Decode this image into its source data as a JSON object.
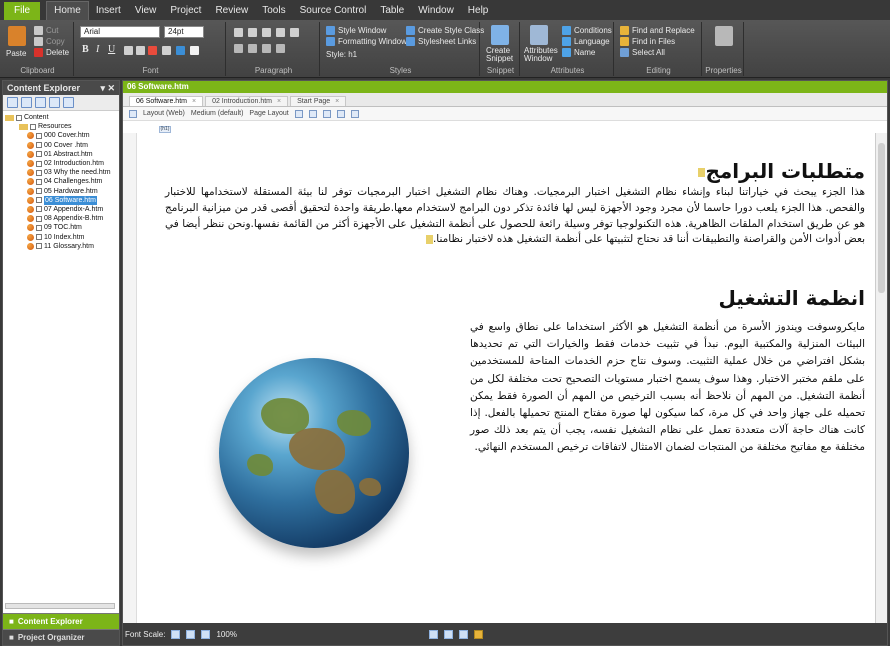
{
  "ribbon_tabs": [
    "File",
    "Home",
    "Insert",
    "View",
    "Project",
    "Review",
    "Tools",
    "Source Control",
    "Table",
    "Window",
    "Help"
  ],
  "clipboard": {
    "paste": "Paste",
    "cut": "Cut",
    "copy": "Copy",
    "delete": "Delete",
    "label": "Clipboard"
  },
  "font": {
    "family": "Arial",
    "size": "24pt",
    "label": "Font"
  },
  "paragraph": {
    "label": "Paragraph"
  },
  "styles": {
    "style_window": "Style Window",
    "formatting_window": "Formatting Window",
    "style_value": "Style: h1",
    "create_style_class": "Create Style Class",
    "stylesheet_links": "Stylesheet Links",
    "label": "Styles"
  },
  "snippet": {
    "create": "Create Snippet",
    "label": "Snippet"
  },
  "attributes": {
    "window": "Attributes Window",
    "conditions": "Conditions",
    "language": "Language",
    "name": "Name",
    "label": "Attributes"
  },
  "editing": {
    "find_replace": "Find and Replace",
    "find_in_files": "Find in Files",
    "select_all": "Select All",
    "label": "Editing"
  },
  "properties": {
    "label": "Properties"
  },
  "explorer": {
    "title": "Content Explorer",
    "root": "Content",
    "items": [
      "Resources",
      "000 Cover.htm",
      "00 Cover .htm",
      "01 Abstract.htm",
      "02 Introduction.htm",
      "03 Why the need.htm",
      "04 Challenges.htm",
      "05 Hardware.htm",
      "06 Software.htm",
      "07 Appendix-A.htm",
      "08 Appendix-B.htm",
      "09 TOC.htm",
      "10 Index.htm",
      "11 Glossary.htm"
    ],
    "selected_index": 8,
    "bottom_buttons": [
      "Content Explorer",
      "Project Organizer"
    ]
  },
  "document": {
    "window_title": "06 Software.htm",
    "tabs": [
      "06 Software.htm",
      "02 Introduction.htm",
      "Start Page"
    ],
    "toolbar": {
      "layout": "Layout (Web)",
      "medium": "Medium (default)",
      "page_layout": "Page Layout"
    },
    "tag": "(h1)",
    "heading1": "متطلبات البرامج",
    "para1": "هذا الجزء يبحث في خياراتنا لبناء وإنشاء نظام التشغيل اختبار البرمجيات. وهناك نظام التشغيل اختبار البرمجيات توفر لنا بيئة المستقلة لاستخدامها للاختبار والفحص. هذا الجزء يلعب دورا حاسما لأن مجرد وجود الأجهزة ليس لها فائدة تذكر دون البرامج لاستخدام معها.طريقة واحدة لتحقيق أقصى قدر من ميزانية البرنامج هو عن طريق استخدام الملقات الظاهرية. هذه التكنولوجيا توفر وسيلة رائعة للحصول على أنظمة التشغيل على الأجهزة أكثر من القائمة نفسها.ونحن ننظر أيضا في بعض أدوات الأمن والقراصنة والتطبيقات أننا قد نحتاج لتثبيتها على أنظمة التشغيل هذه لاختبار نظامنا.",
    "heading2": "انظمة التشغيل",
    "para2": "مايكروسوفت ويندوز الأسرة من أنظمة التشغيل هو الأكثر استخداما على نطاق واسع في البيئات المنزلية والمكتبية اليوم. نبدأ في تثبيت خدمات فقط والخيارات التي تم تحديدها بشكل افتراضي من خلال عملية التثبيت. وسوف نتاح حزم الخدمات المتاحة للمستخدمين على ملقم مختبر الاختبار. وهذا سوف يسمح اختبار مستويات التصحيح تحت مختلفة لكل من أنظمة التشغيل. من المهم أن نلاحظ أنه بسبب الترخيص من المهم أن الصورة فقط يمكن تحميله على جهاز واحد في كل مرة، كما سيكون لها صورة مفتاح المنتج تحميلها بالفعل. إذا كانت هناك حاجة آلات متعددة تعمل على نظام التشغيل نفسه، يجب أن يتم بعد ذلك صور مختلفة مع مفاتيح مختلفة من المنتجات لضمان الامتثال لاتفاقات ترخيص المستخدم النهائي."
  },
  "status": {
    "font_scale": "Font Scale:",
    "zoom": "100%"
  },
  "colors": {
    "accent": "#7cb518",
    "ribbon": "#4a4a4a",
    "selection": "#3b8ed6"
  }
}
